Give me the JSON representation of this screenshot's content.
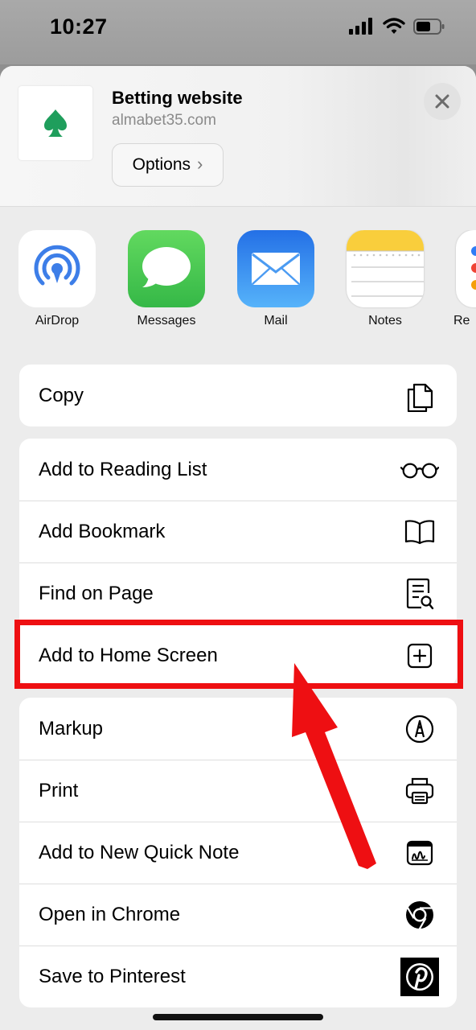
{
  "status_bar": {
    "time": "10:27"
  },
  "share_header": {
    "title": "Betting website",
    "url": "almabet35.com",
    "options_label": "Options",
    "options_chevron": "›"
  },
  "apps": [
    {
      "label": "AirDrop",
      "icon": "airdrop-icon"
    },
    {
      "label": "Messages",
      "icon": "messages-icon"
    },
    {
      "label": "Mail",
      "icon": "mail-icon"
    },
    {
      "label": "Notes",
      "icon": "notes-icon"
    },
    {
      "label": "Re",
      "icon": "reminders-icon"
    }
  ],
  "actions": {
    "group1": [
      {
        "label": "Copy",
        "icon": "copy-icon"
      }
    ],
    "group2": [
      {
        "label": "Add to Reading List",
        "icon": "glasses-icon"
      },
      {
        "label": "Add Bookmark",
        "icon": "book-icon"
      },
      {
        "label": "Find on Page",
        "icon": "find-document-icon"
      },
      {
        "label": "Add to Home Screen",
        "icon": "plus-square-icon"
      }
    ],
    "group3": [
      {
        "label": "Markup",
        "icon": "markup-pen-icon"
      },
      {
        "label": "Print",
        "icon": "printer-icon"
      },
      {
        "label": "Add to New Quick Note",
        "icon": "quick-note-icon"
      },
      {
        "label": "Open in Chrome",
        "icon": "chrome-icon"
      },
      {
        "label": "Save to Pinterest",
        "icon": "pinterest-icon"
      }
    ]
  },
  "colors": {
    "highlight": "#ee0f12",
    "arrow": "#ee0f12",
    "messages_green": "#34c759",
    "mail_blue": "#2f8ef4",
    "airdrop_blue": "#3d7ee8",
    "brand_green": "#1f9e5c"
  }
}
